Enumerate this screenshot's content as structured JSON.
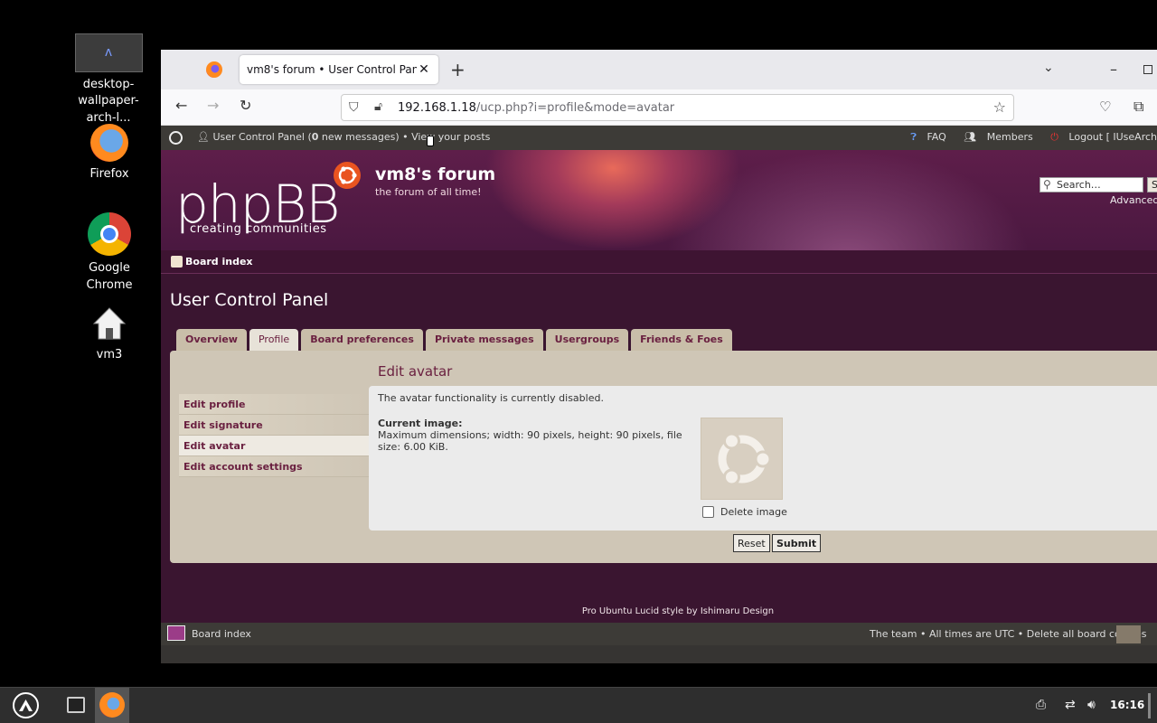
{
  "desktop": {
    "icons": [
      {
        "label": "desktop-\nwallpaper-arch-l...",
        "line1": "desktop-",
        "line2": "wallpaper-arch-l..."
      },
      {
        "label": "Firefox"
      },
      {
        "label": "Google Chrome"
      },
      {
        "label": "vm3"
      }
    ]
  },
  "browser": {
    "tab_title": "vm8's forum • User Control Panel",
    "url_host": "192.168.1.18",
    "url_path": "/ucp.php?i=profile&mode=avatar"
  },
  "forum": {
    "topbar": {
      "ucp_text": "User Control Panel (",
      "msg_count": "0",
      "msg_text": " new messages) • View your posts",
      "faq": "FAQ",
      "members": "Members",
      "logout": "Logout [ IUseArch"
    },
    "logo": "phpBB",
    "logo_sub": "creating      communities",
    "site_title": "vm8's forum",
    "site_desc": "the forum of all time!",
    "search_placeholder": "Search…",
    "search_btn": "S",
    "advanced": "Advanced",
    "breadcrumb": "Board index",
    "page_title": "User Control Panel",
    "tabs": [
      "Overview",
      "Profile",
      "Board preferences",
      "Private messages",
      "Usergroups",
      "Friends & Foes"
    ],
    "menu": [
      "Edit profile",
      "Edit signature",
      "Edit avatar",
      "Edit account settings"
    ],
    "section_title": "Edit avatar",
    "disabled_msg": "The avatar functionality is currently disabled.",
    "current_image_label": "Current image:",
    "current_image_desc": "Maximum dimensions; width: 90 pixels, height: 90 pixels, file size: 6.00 KiB.",
    "delete_label": "Delete image",
    "reset": "Reset",
    "submit": "Submit",
    "credit": "Pro Ubuntu Lucid style by Ishimaru Design",
    "footer_left": "Board index",
    "footer_right": "The team • All times are UTC • Delete all board cookies"
  },
  "taskbar": {
    "clock": "16:16"
  }
}
